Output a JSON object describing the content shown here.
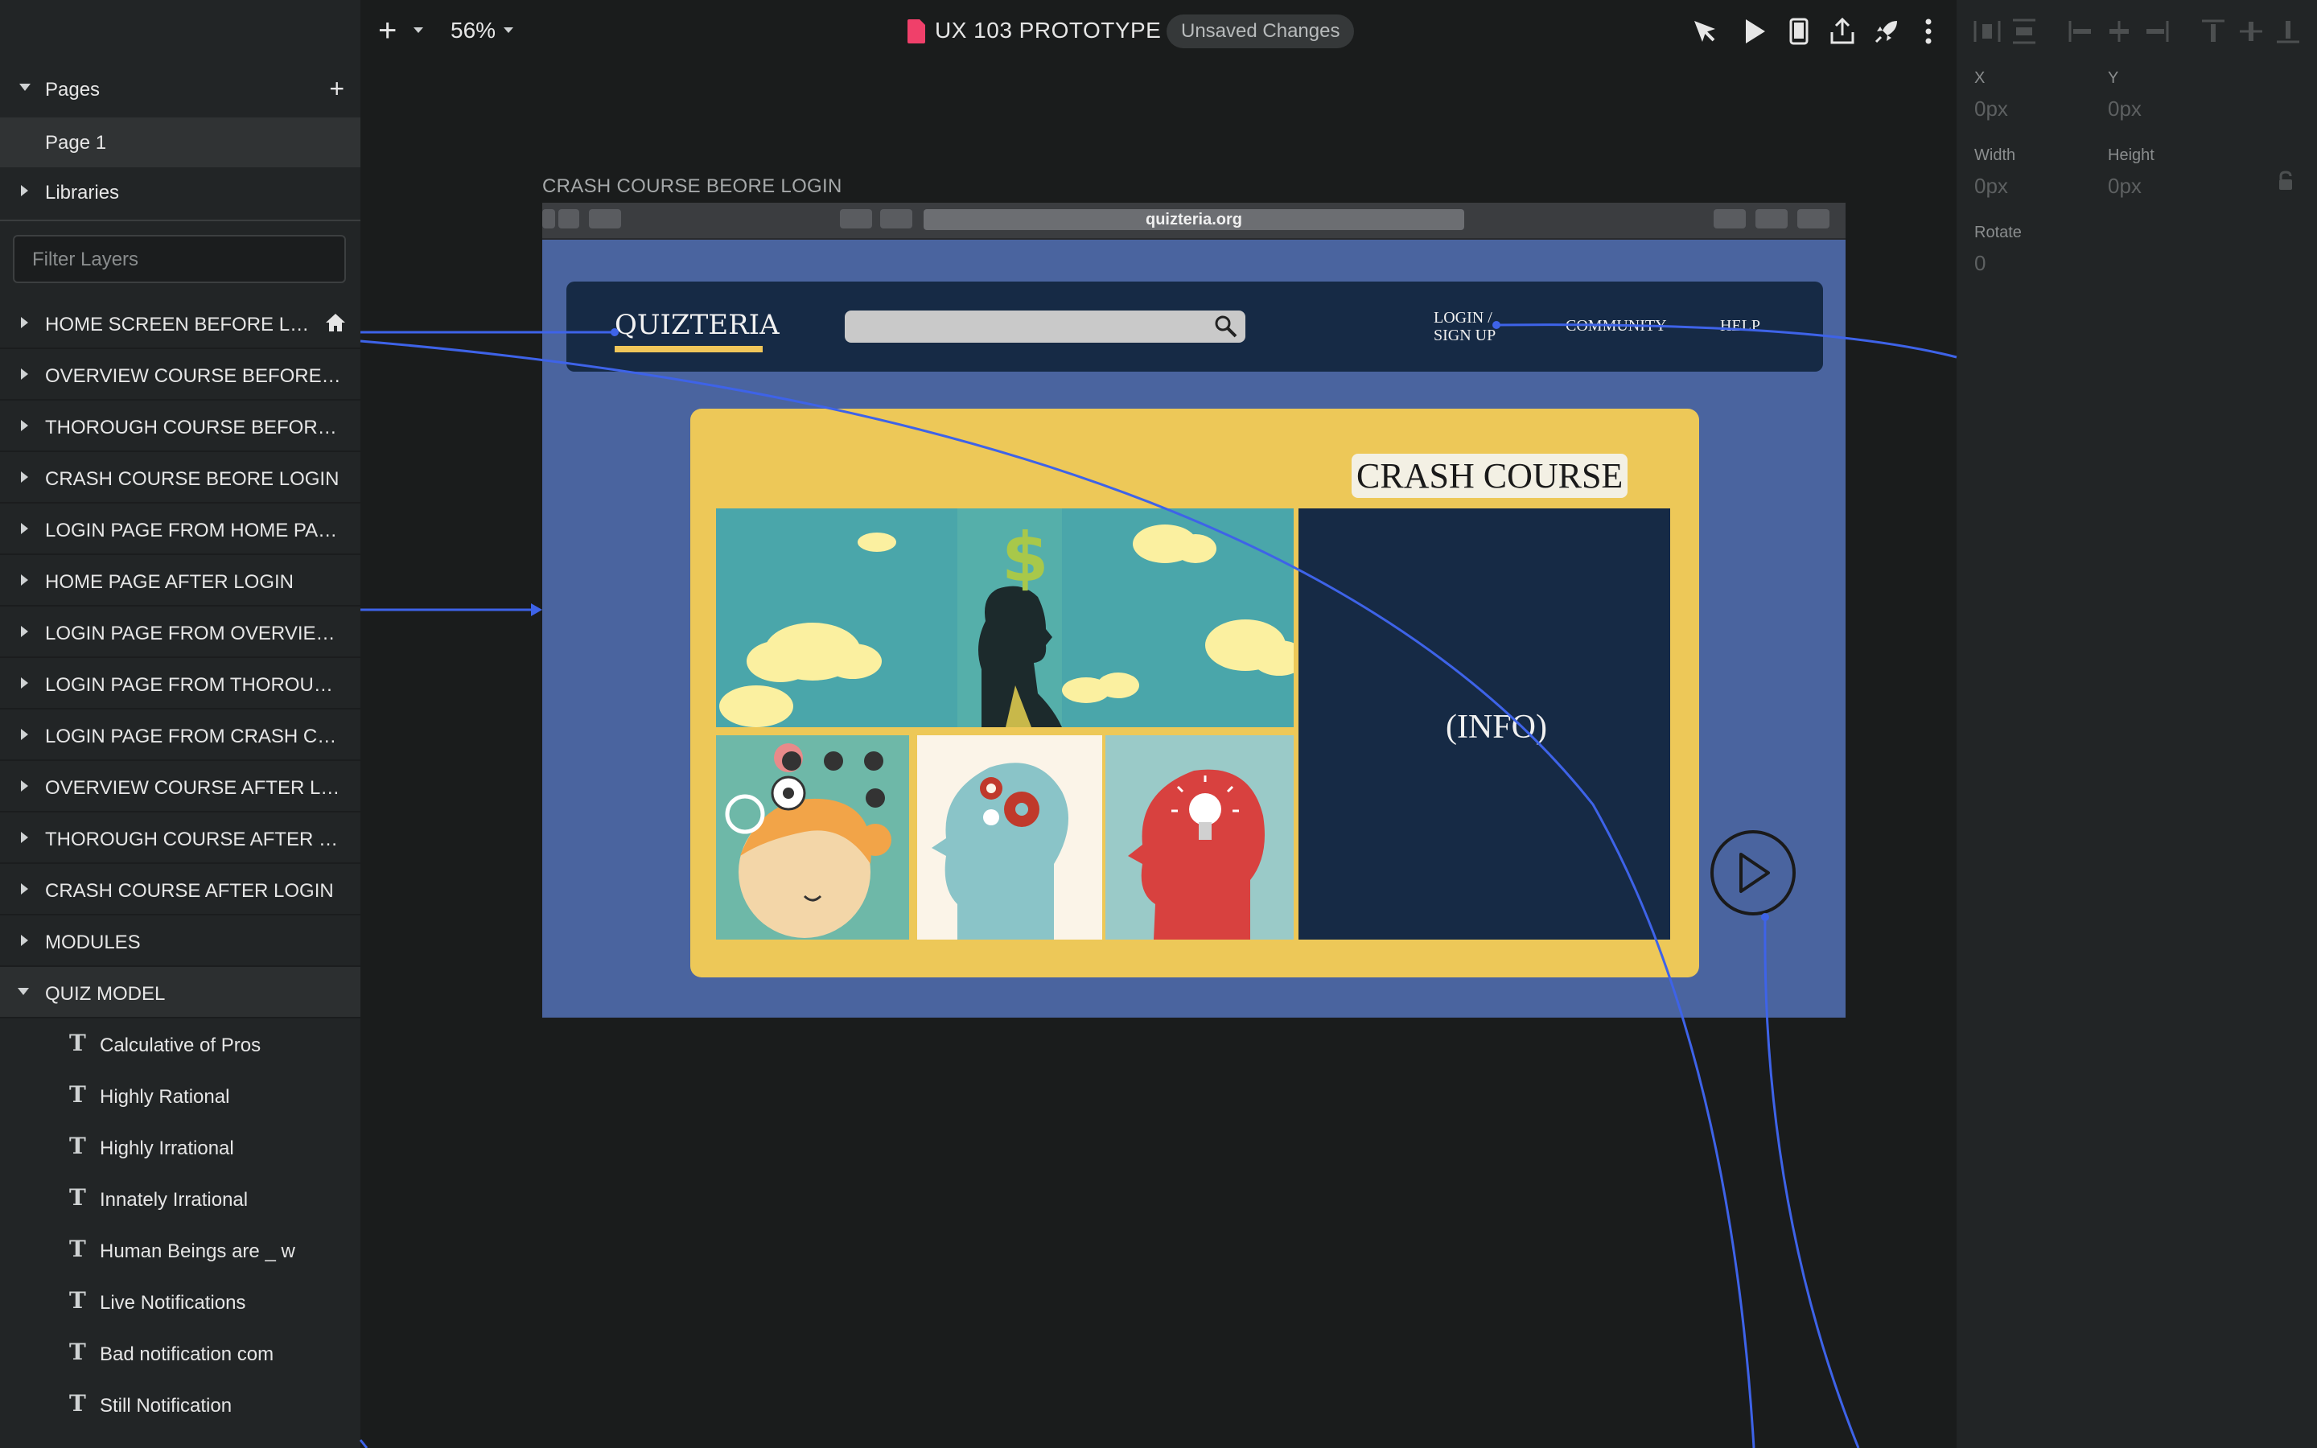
{
  "topbar": {
    "zoom": "56%",
    "doc_title": "UX 103 PROTOTYPE",
    "save_status": "Unsaved Changes"
  },
  "sidebar": {
    "pages_header": "Pages",
    "pages": [
      {
        "label": "Page 1"
      }
    ],
    "libraries": "Libraries",
    "filter_placeholder": "Filter Layers",
    "layers": [
      {
        "label": "HOME SCREEN BEFORE LOGIN",
        "home": true
      },
      {
        "label": "OVERVIEW COURSE BEFORE LOGIN"
      },
      {
        "label": "THOROUGH COURSE BEFORE LOGIN"
      },
      {
        "label": "CRASH COURSE BEORE LOGIN"
      },
      {
        "label": "LOGIN PAGE FROM HOME PAGE"
      },
      {
        "label": "HOME PAGE AFTER LOGIN"
      },
      {
        "label": "LOGIN PAGE FROM OVERVIEW COURSE"
      },
      {
        "label": "LOGIN PAGE FROM THOROUGH COURSE"
      },
      {
        "label": "LOGIN PAGE FROM CRASH COURSE"
      },
      {
        "label": "OVERVIEW COURSE AFTER LOGIN"
      },
      {
        "label": "THOROUGH COURSE AFTER LOGIN"
      },
      {
        "label": "CRASH COURSE AFTER LOGIN"
      },
      {
        "label": "MODULES"
      },
      {
        "label": "QUIZ MODEL",
        "expanded": true
      }
    ],
    "quiz_children": [
      "Calculative of Pros",
      "Highly Rational",
      "Highly Irrational",
      "Innately Irrational",
      "Human Beings are _ w",
      "Live Notifications",
      "Bad notification com",
      "Still Notification"
    ]
  },
  "inspector": {
    "x_label": "X",
    "x_value": "0px",
    "y_label": "Y",
    "y_value": "0px",
    "width_label": "Width",
    "width_value": "0px",
    "height_label": "Height",
    "height_value": "0px",
    "rotate_label": "Rotate",
    "rotate_value": "0"
  },
  "canvas": {
    "artboard_label": "CRASH COURSE BEORE LOGIN",
    "browser_url": "quizteria.org",
    "site": {
      "logo": "QUIZTERIA",
      "nav_login_line1": "LOGIN /",
      "nav_login_line2": "SIGN UP",
      "nav_community": "COMMUNITY",
      "nav_help": "HELP",
      "course_title": "CRASH COURSE",
      "info_text": "(INFO)"
    }
  },
  "colors": {
    "app_bg": "#1a1c1c",
    "panel_bg": "#222526",
    "artboard_bg": "#4a649f",
    "site_navy": "#162a45",
    "card_yellow": "#edc858",
    "wire_blue": "#3e63e8"
  }
}
